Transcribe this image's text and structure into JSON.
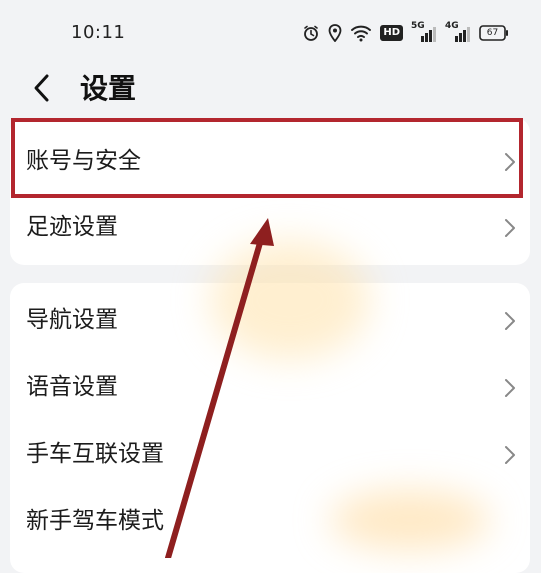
{
  "status_bar": {
    "time": "10:11",
    "icons": [
      "alarm-icon",
      "location-icon",
      "wifi-icon",
      "hd-icon",
      "signal-5g-icon",
      "signal-4g-icon",
      "battery-icon"
    ],
    "hd_label": "HD",
    "net1_label": "5G",
    "net2_label": "4G",
    "battery_level": "67"
  },
  "header": {
    "back_icon": "chevron-left-icon",
    "title": "设置"
  },
  "group1": {
    "items": [
      {
        "label": "账号与安全"
      },
      {
        "label": "足迹设置"
      }
    ]
  },
  "group2": {
    "items": [
      {
        "label": "导航设置"
      },
      {
        "label": "语音设置"
      },
      {
        "label": "手车互联设置"
      },
      {
        "label": "新手驾车模式"
      }
    ]
  },
  "colors": {
    "highlight": "#b3262e",
    "arrow": "#8e1f1f",
    "background": "#f2f3f5",
    "card": "#ffffff"
  }
}
